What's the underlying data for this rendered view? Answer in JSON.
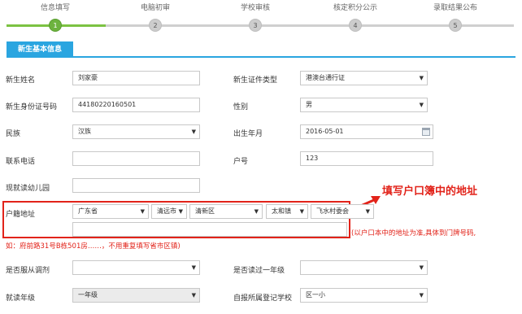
{
  "steps": [
    {
      "label": "信息填写",
      "num": "1",
      "active": true
    },
    {
      "label": "电脑初审",
      "num": "2",
      "active": false
    },
    {
      "label": "学校审核",
      "num": "3",
      "active": false
    },
    {
      "label": "核定积分公示",
      "num": "4",
      "active": false
    },
    {
      "label": "录取结果公布",
      "num": "5",
      "active": false
    }
  ],
  "section_title": "新生基本信息",
  "form": {
    "name_label": "新生姓名",
    "name_value": "刘家豪",
    "id_type_label": "新生证件类型",
    "id_type_value": "港澳台通行证",
    "id_number_label": "新生身份证号码",
    "id_number_value": "44180220160501",
    "gender_label": "性别",
    "gender_value": "男",
    "ethnicity_label": "民族",
    "ethnicity_value": "汉族",
    "birth_label": "出生年月",
    "birth_value": "2016-05-01",
    "phone_label": "联系电话",
    "phone_value": "",
    "household_no_label": "户号",
    "household_no_value": "123",
    "kindergarten_label": "现就读幼儿园",
    "kindergarten_value": "",
    "hukou_label": "户籍地址",
    "hukou_province": "广东省",
    "hukou_city": "清远市",
    "hukou_district": "清新区",
    "hukou_town": "太和镇",
    "hukou_village": "飞水村委会",
    "hukou_detail": "",
    "obey_label": "是否服从调剂",
    "obey_value": "",
    "grade1_label": "是否读过一年级",
    "grade1_value": "",
    "grade_label": "就读年级",
    "grade_value": "一年级",
    "school_label": "自报所属登记学校",
    "school_value": "区一小"
  },
  "annotation": "填写户口簿中的地址",
  "hint_line1": "(以户口本中的地址为准,具体到门牌号码,",
  "hint_line2": "如：府前路31号B栋501房……，不用重复填写省市区镇)",
  "colors": {
    "accent": "#2aa5e0",
    "step_active": "#6db33f",
    "warning": "#e2231a"
  }
}
